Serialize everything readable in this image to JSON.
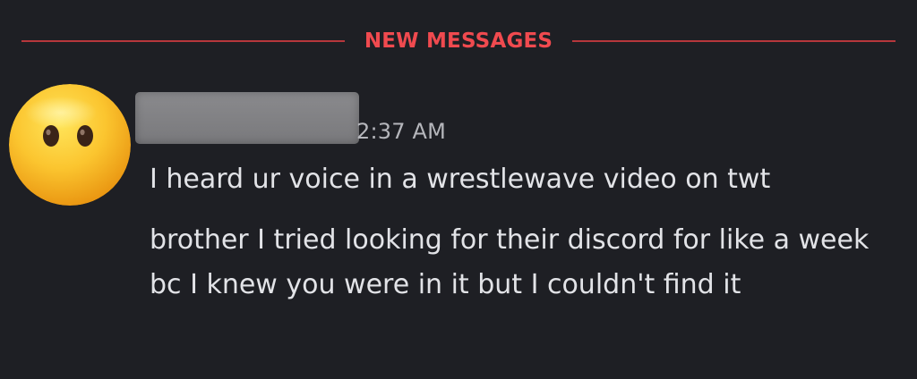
{
  "divider": {
    "label": "NEW MESSAGES",
    "color": "#f04a4f"
  },
  "message_group": {
    "avatar": {
      "icon": "neutral-face-emoji-icon"
    },
    "author": {
      "name_redacted": true
    },
    "timestamp": "2:37 AM",
    "messages": [
      {
        "text": "I heard ur voice in a wrestlewave video on twt"
      },
      {
        "text": "brother I tried looking for their discord for like a week bc I knew you were in it but I couldn't find it"
      }
    ]
  },
  "colors": {
    "background": "#1e1f24",
    "message_text": "#e2e3e7",
    "timestamp_text": "#b5b6bb",
    "new_messages_red": "#f04a4f"
  }
}
